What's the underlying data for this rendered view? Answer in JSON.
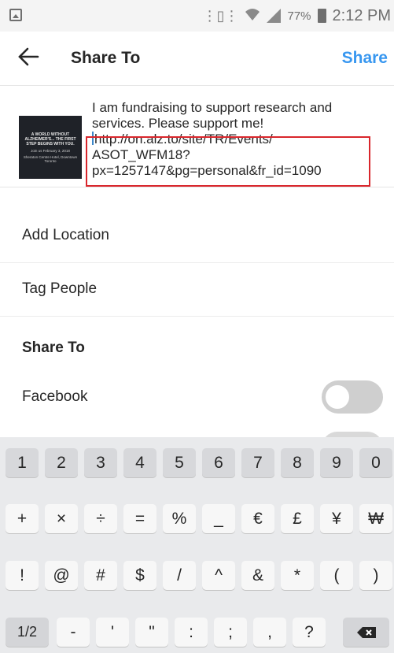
{
  "status_bar": {
    "battery_pct": "77%",
    "time": "2:12 PM",
    "icons": [
      "gallery-icon",
      "vibrate-icon",
      "wifi-icon",
      "signal-icon",
      "battery-icon"
    ]
  },
  "header": {
    "title": "Share To",
    "share_label": "Share",
    "back_icon": "back-arrow-icon",
    "share_color": "#3897f0"
  },
  "post": {
    "thumb_line1": "A WORLD WITHOUT ALZHEIMER'S... THE FIRST STEP BEGINS WITH YOU.",
    "thumb_line2": "Join us February 3, 2018",
    "thumb_line3": "Sheraton Centre Hotel, Downtown Toronto",
    "caption_line1": "I am fundraising to support research and",
    "caption_line2": "services.  Please support me!",
    "caption_line3": "http://on.alz.to/site/TR/Events/",
    "caption_line4": "ASOT_WFM18?",
    "caption_line5": "px=1257147&pg=personal&fr_id=1090",
    "highlight_color": "#d9262c"
  },
  "options": {
    "add_location": "Add Location",
    "tag_people": "Tag People",
    "share_to_section": "Share To",
    "facebook": "Facebook"
  },
  "keyboard": {
    "row1": [
      "1",
      "2",
      "3",
      "4",
      "5",
      "6",
      "7",
      "8",
      "9",
      "0"
    ],
    "row2": [
      "+",
      "×",
      "÷",
      "=",
      "%",
      "_",
      "€",
      "£",
      "¥",
      "₩"
    ],
    "row3": [
      "!",
      "@",
      "#",
      "$",
      "/",
      "^",
      "&",
      "*",
      "(",
      ")"
    ],
    "row4": [
      "1/2",
      "-",
      "'",
      "\"",
      ":",
      ";",
      ",",
      "?"
    ],
    "backspace_icon": "backspace-icon"
  }
}
